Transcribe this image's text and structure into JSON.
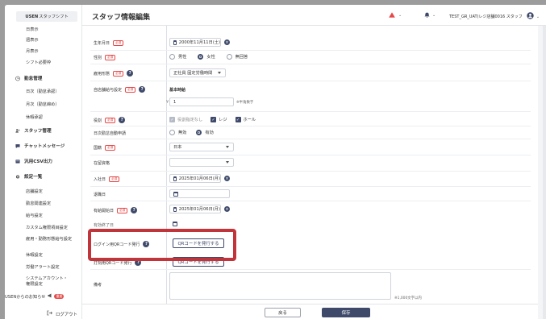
{
  "sidebar": {
    "logo": "USEN",
    "app_name": "スタッフシフト",
    "items_top": [
      "日表示",
      "週表示",
      "月表示",
      "シフト必要枠"
    ],
    "section_attendance": "勤怠管理",
    "attendance_items": [
      "日次（勤怠承認）",
      "月次（勤怠締め）",
      "休暇承認"
    ],
    "section_staff": "スタッフ管理",
    "section_chat": "チャットメッセージ",
    "section_csv": "汎用CSV出力",
    "section_settings": "設定一覧",
    "settings_items": [
      "店舗設定",
      "勤怠関連設定",
      "給与設定",
      "カスタム権限項目設定",
      "雇用・勤務形態給与設定",
      "休暇設定",
      "労働アラート設定",
      "システムアカウント・権限設定"
    ],
    "notice_label": "USENからのお知らせ",
    "notice_badge": "重要",
    "logout_label": "ログアウト"
  },
  "header": {
    "title": "スタッフ情報編集",
    "store_label": "TEST_GR_UAT(レジ店舗0016 スタッフ"
  },
  "form": {
    "birthday_label": "生年月日",
    "birthday_value": "2000年11月11日(土)",
    "gender_label": "性別",
    "gender_options": [
      "男性",
      "女性",
      "無回答"
    ],
    "employment_label": "雇用形態",
    "employment_value": "正社員 固定労働時間",
    "wage_label": "自店舗給与設定",
    "wage_type": "基本時給",
    "wage_prefix": "¥",
    "wage_value": "1",
    "wage_hint": "※半角数字",
    "role_label": "役割",
    "role_options": [
      "役割指定なし",
      "レジ",
      "ホール"
    ],
    "auto_break_label": "日次勤怠自動申請",
    "auto_break_options": [
      "無効",
      "有効"
    ],
    "nationality_label": "国籍",
    "nationality_value": "日本",
    "residence_label": "在留資格",
    "residence_value": "",
    "hire_label": "入社日",
    "hire_value": "2025年01月06日(月)",
    "leave_label": "退職日",
    "paid_start_label": "有給開始日",
    "paid_start_value": "2025年01月06日(月)",
    "paid_end_label": "有効終了日",
    "login_qr_label": "ログイン用QRコード発行",
    "login_qr_button": "QRコードを発行する",
    "punch_qr_label": "打刻用QRコード発行",
    "punch_qr_button": "QRコードを発行する",
    "note_label": "備考",
    "note_hint": "※1,000文字以内",
    "required_badge": "必須"
  },
  "footer": {
    "back_label": "戻る",
    "save_label": "保存"
  },
  "colors": {
    "accent": "#3f4a6b",
    "required": "#e54848",
    "highlight": "#c0343a"
  }
}
